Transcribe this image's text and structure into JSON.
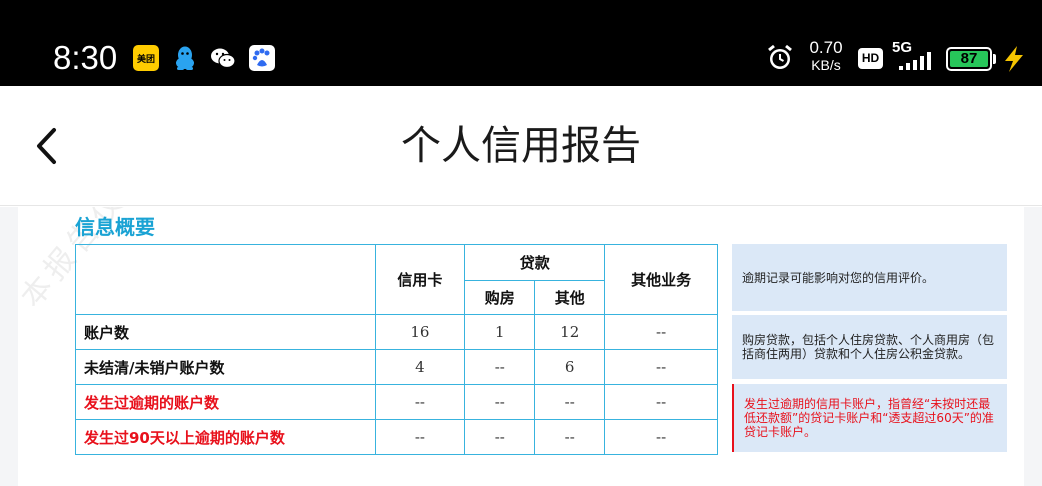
{
  "status_bar": {
    "time": "8:30",
    "meituan_label": "美团",
    "net_speed_value": "0.70",
    "net_speed_unit": "KB/s",
    "hd_label": "HD",
    "network_label": "5G",
    "battery_level": "87",
    "battery_color": "#27c65a"
  },
  "nav": {
    "title": "个人信用报告"
  },
  "report": {
    "section_title": "信息概要",
    "headers": {
      "credit_card": "信用卡",
      "loan": "贷款",
      "housing": "购房",
      "other": "其他",
      "other_business": "其他业务"
    },
    "rows": [
      {
        "label": "账户数",
        "credit_card": "16",
        "housing": "1",
        "other": "12",
        "other_business": "--"
      },
      {
        "label": "未结清/未销户账户数",
        "credit_card": "4",
        "housing": "--",
        "other": "6",
        "other_business": "--"
      },
      {
        "label": "发生过逾期的账户数",
        "credit_card": "--",
        "housing": "--",
        "other": "--",
        "other_business": "--"
      },
      {
        "label": "发生过90天以上逾期的账户数",
        "credit_card": "--",
        "housing": "--",
        "other": "--",
        "other_business": "--"
      }
    ],
    "notes": [
      "逾期记录可能影响对您的信用评价。",
      "购房贷款，包括个人住房贷款、个人商用房（包括商住两用）贷款和个人住房公积金贷款。",
      "发生过逾期的信用卡账户，指曾经“未按时还最低还款额”的贷记卡账户和“透支超过60天”的准贷记卡账户。"
    ],
    "accent_color": "#38b3de",
    "alert_color": "#e8111c"
  }
}
